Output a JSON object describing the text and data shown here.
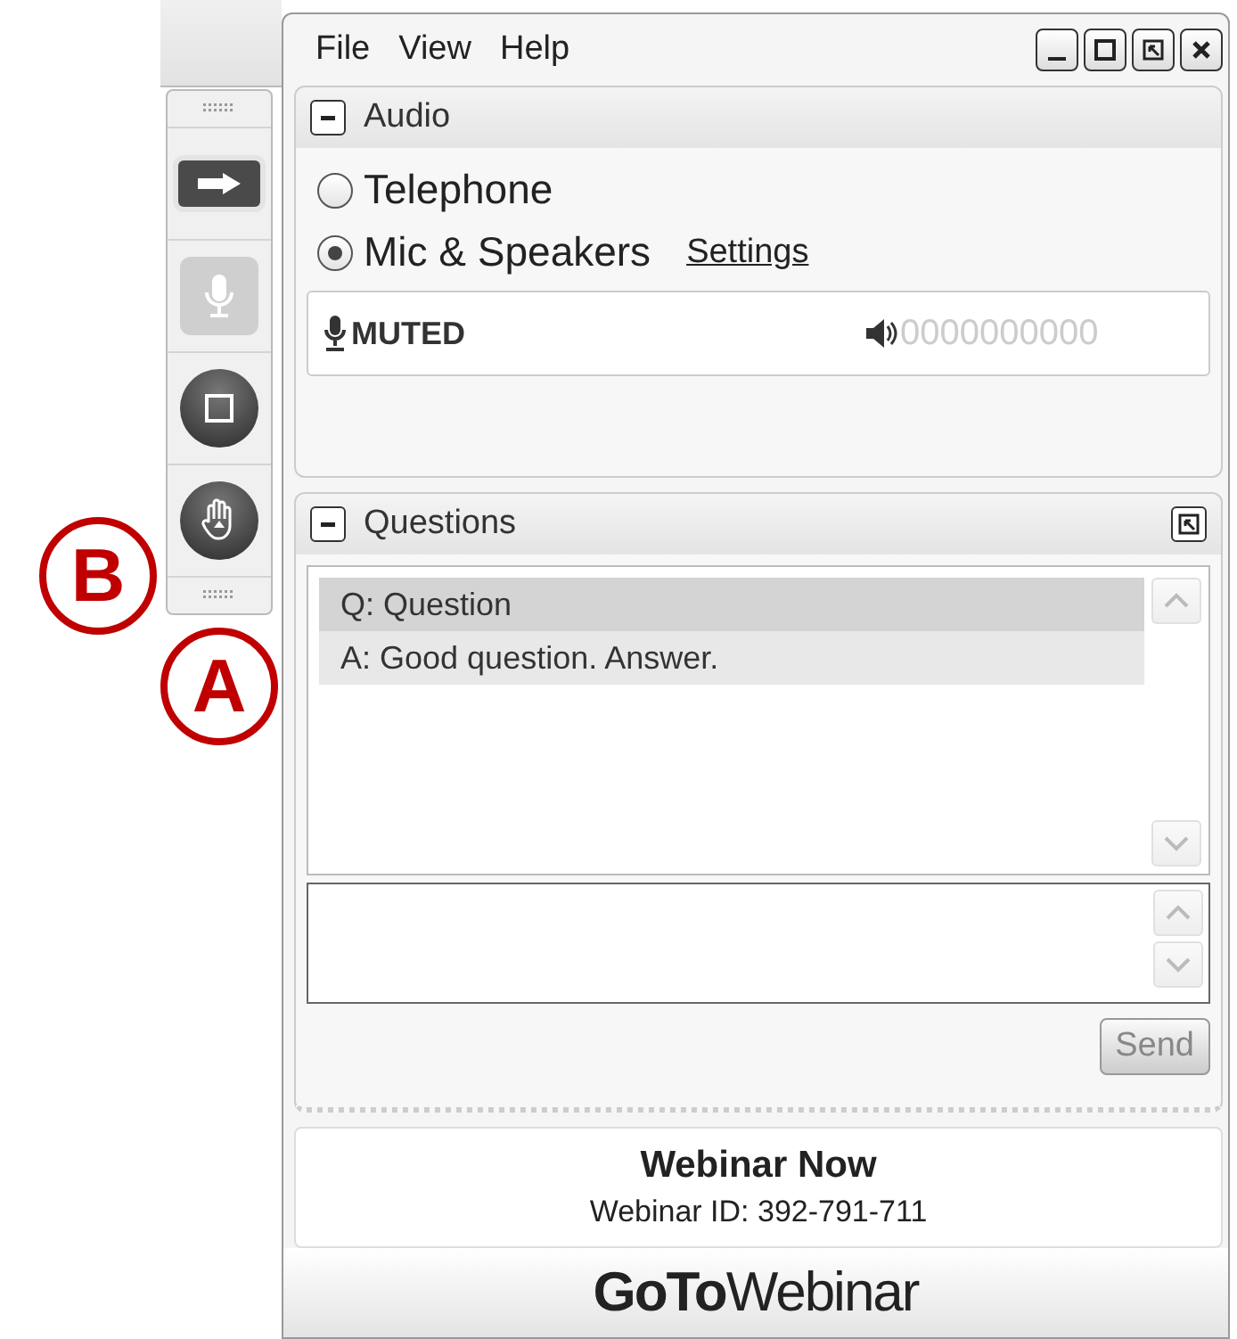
{
  "menu": [
    "File",
    "View",
    "Help"
  ],
  "toolbar": {
    "buttons": [
      {
        "kind": "arrow",
        "disabled": false
      },
      {
        "kind": "mic",
        "disabled": true
      },
      {
        "kind": "stop",
        "disabled": false
      },
      {
        "kind": "hand",
        "disabled": false
      }
    ]
  },
  "audio": {
    "title": "Audio",
    "expanded": true,
    "options": [
      {
        "label": "Telephone",
        "selected": false
      },
      {
        "label": "Mic & Speakers",
        "selected": true
      }
    ],
    "settings_link": "Settings",
    "mic_status": "MUTED",
    "speaker_meter": "0000000000"
  },
  "questions": {
    "title": "Questions",
    "expanded": true,
    "items": [
      {
        "text": "Q: Question",
        "selected": true
      },
      {
        "text": "A: Good question. Answer.",
        "selected": false
      }
    ],
    "send_button": {
      "label": "Send",
      "disabled": true
    }
  },
  "webinar": {
    "name": "Webinar Now",
    "id_text": "Webinar ID: 392-791-711"
  },
  "logo": "**GoTo**Webinar",
  "callouts": [
    {
      "label": "B"
    },
    {
      "label": "A"
    }
  ]
}
